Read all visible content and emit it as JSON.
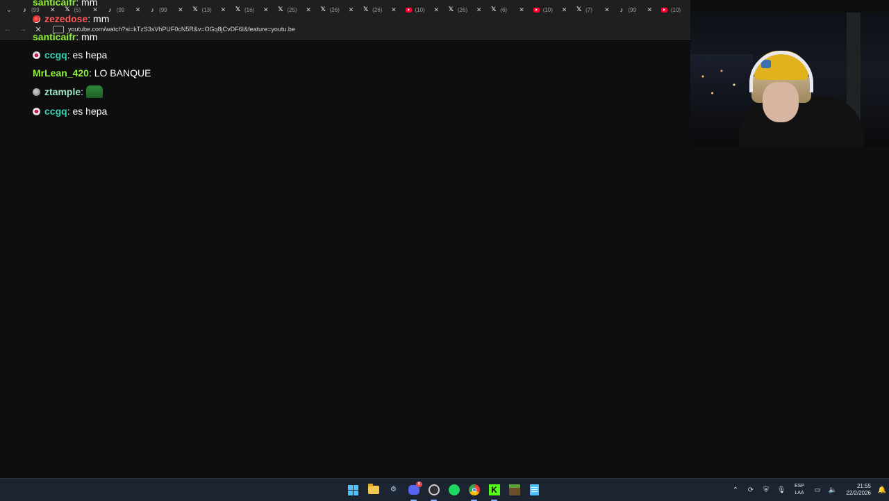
{
  "browser": {
    "tabs": [
      {
        "icon": "tiktok-icon",
        "label": "(99"
      },
      {
        "icon": "x-icon",
        "label": "(5)"
      },
      {
        "icon": "tiktok-icon",
        "label": "(99"
      },
      {
        "icon": "tiktok-icon",
        "label": "(99"
      },
      {
        "icon": "x-icon",
        "label": "(13)"
      },
      {
        "icon": "x-icon",
        "label": "(16)"
      },
      {
        "icon": "x-icon",
        "label": "(25)"
      },
      {
        "icon": "x-icon",
        "label": "(26)"
      },
      {
        "icon": "x-icon",
        "label": "(26)"
      },
      {
        "icon": "youtube-icon",
        "label": "(10)"
      },
      {
        "icon": "x-icon",
        "label": "(26)"
      },
      {
        "icon": "x-icon",
        "label": "(6)"
      },
      {
        "icon": "youtube-icon",
        "label": "(10)"
      },
      {
        "icon": "x-icon",
        "label": "(7)"
      },
      {
        "icon": "tiktok-icon",
        "label": "(99"
      },
      {
        "icon": "youtube-icon",
        "label": "(10)"
      }
    ],
    "close_glyph": "✕",
    "url": "youtube.com/watch?si=kTzS3sVhPUF0cN5R&v=OGq8jCvDF6I&feature=youtu.be"
  },
  "chat": {
    "lines": [
      {
        "badge": "none",
        "user": "santicaifr",
        "user_color": "#8ff03c",
        "message": ": mm"
      },
      {
        "badge": "red",
        "user": "zezedose",
        "user_color": "#ff5a5a",
        "message": ": mm"
      },
      {
        "badge": "none",
        "user": "santicaifr",
        "user_color": "#8ff03c",
        "message": ": mm"
      },
      {
        "badge": "pink",
        "user": "ccgq",
        "user_color": "#2fd3b4",
        "message": ": es hepa"
      },
      {
        "badge": "none",
        "user": "MrLean_420",
        "user_color": "#8ff03c",
        "message": ": LO BANQUE"
      },
      {
        "badge": "grey",
        "user": "ztample",
        "user_color": "#9ee6c8",
        "message": ":",
        "emote": true
      },
      {
        "badge": "pink",
        "user": "ccgq",
        "user_color": "#2fd3b4",
        "message": ": es hepa"
      }
    ]
  },
  "taskbar": {
    "apps": [
      "windows-start-icon",
      "file-explorer-icon",
      "steam-icon",
      "discord-icon",
      "obs-icon",
      "spotify-icon",
      "chrome-icon",
      "kick-icon",
      "minecraft-icon",
      "notepad-icon"
    ],
    "discord_badge": "9",
    "lang_line1": "ESP",
    "lang_line2": "LAA",
    "time": "21:55",
    "date": "22/2/2026"
  },
  "colors": {
    "background": "#0e0e0e",
    "chrome": "#1f1f1f",
    "taskbar": "#1c2431"
  }
}
